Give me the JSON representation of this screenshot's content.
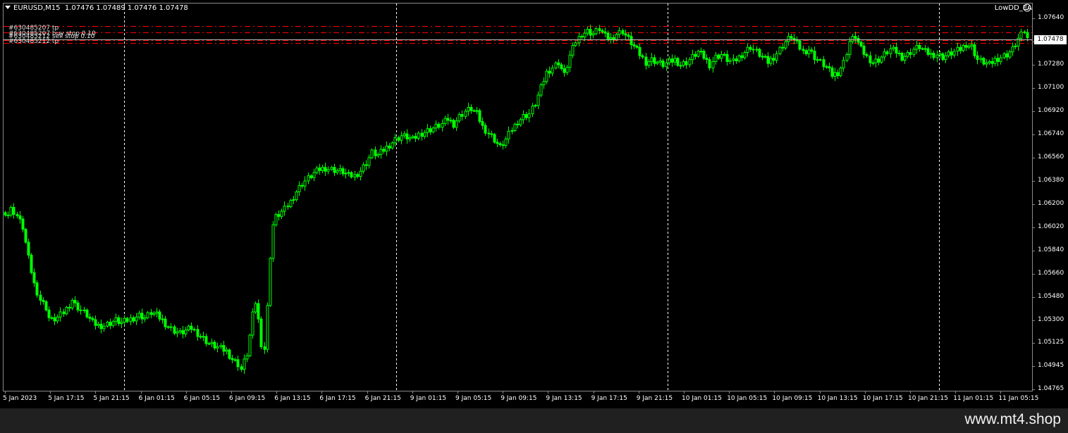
{
  "header": {
    "symbol": "EURUSD,M15",
    "ohlc": "1.07476 1.07489 1.07476 1.07478",
    "ea_name": "LowDD_EA"
  },
  "colors": {
    "background": "#000000",
    "candle": "#00ff00",
    "order_line": "#ff0000",
    "bid_line": "#c0c0c0",
    "grid": "#ffffff",
    "bottom_bar": "#202020"
  },
  "price_axis": [
    "1.07640",
    "1.07460",
    "1.07280",
    "1.07100",
    "1.06920",
    "1.06740",
    "1.06560",
    "1.06380",
    "1.06200",
    "1.06020",
    "1.05840",
    "1.05660",
    "1.05480",
    "1.05300",
    "1.05125",
    "1.04945",
    "1.04765"
  ],
  "current_price": "1.07478",
  "time_axis": [
    "5 Jan 2023",
    "5 Jan 17:15",
    "5 Jan 21:15",
    "6 Jan 01:15",
    "6 Jan 05:15",
    "6 Jan 09:15",
    "6 Jan 13:15",
    "6 Jan 17:15",
    "6 Jan 21:15",
    "9 Jan 01:15",
    "9 Jan 05:15",
    "9 Jan 09:15",
    "9 Jan 13:15",
    "9 Jan 17:15",
    "9 Jan 21:15",
    "10 Jan 01:15",
    "10 Jan 05:15",
    "10 Jan 09:15",
    "10 Jan 13:15",
    "10 Jan 17:15",
    "10 Jan 21:15",
    "11 Jan 01:15",
    "11 Jan 05:15"
  ],
  "order_labels": [
    "#630485207 tp",
    "#630485207 buy stop 0.10",
    "#630485212 sell stop 0.10",
    "#630485212 tp"
  ],
  "order_levels": [
    1.0758,
    1.0753,
    1.0747,
    1.0745
  ],
  "session_separators": [
    "5 Jan 21:15",
    "6 Jan 21:15",
    "9 Jan 21:15",
    "10 Jan 21:15"
  ],
  "price_path": [
    [
      0,
      1.0614
    ],
    [
      1,
      1.0612
    ],
    [
      2,
      1.0616
    ],
    [
      3,
      1.0614
    ],
    [
      4,
      1.0611
    ],
    [
      6,
      1.0602
    ],
    [
      7,
      1.059
    ],
    [
      8,
      1.0578
    ],
    [
      9,
      1.0568
    ],
    [
      10,
      1.0558
    ],
    [
      11,
      1.0552
    ],
    [
      12,
      1.0546
    ],
    [
      14,
      1.054
    ],
    [
      15,
      1.0532
    ],
    [
      16,
      1.053
    ],
    [
      18,
      1.0532
    ],
    [
      20,
      1.0536
    ],
    [
      22,
      1.0542
    ],
    [
      23,
      1.0546
    ],
    [
      24,
      1.0542
    ],
    [
      26,
      1.0538
    ],
    [
      28,
      1.0534
    ],
    [
      30,
      1.0528
    ],
    [
      32,
      1.0526
    ],
    [
      34,
      1.0526
    ],
    [
      36,
      1.0528
    ],
    [
      38,
      1.053
    ],
    [
      40,
      1.0528
    ],
    [
      42,
      1.053
    ],
    [
      44,
      1.0532
    ],
    [
      46,
      1.0534
    ],
    [
      48,
      1.0532
    ],
    [
      50,
      1.0536
    ],
    [
      52,
      1.0534
    ],
    [
      54,
      1.053
    ],
    [
      56,
      1.0525
    ],
    [
      58,
      1.0522
    ],
    [
      60,
      1.052
    ],
    [
      62,
      1.0522
    ],
    [
      64,
      1.0524
    ],
    [
      66,
      1.052
    ],
    [
      68,
      1.0516
    ],
    [
      70,
      1.0512
    ],
    [
      72,
      1.051
    ],
    [
      74,
      1.0508
    ],
    [
      76,
      1.0506
    ],
    [
      78,
      1.05
    ],
    [
      80,
      1.0496
    ],
    [
      81,
      1.0492
    ],
    [
      82,
      1.0498
    ],
    [
      83,
      1.0504
    ],
    [
      84,
      1.0518
    ],
    [
      85,
      1.0534
    ],
    [
      86,
      1.0544
    ],
    [
      87,
      1.053
    ],
    [
      88,
      1.0512
    ],
    [
      89,
      1.0508
    ],
    [
      90,
      1.054
    ],
    [
      91,
      1.058
    ],
    [
      92,
      1.0604
    ],
    [
      93,
      1.061
    ],
    [
      94,
      1.0612
    ],
    [
      96,
      1.0616
    ],
    [
      98,
      1.0622
    ],
    [
      100,
      1.063
    ],
    [
      102,
      1.0636
    ],
    [
      104,
      1.064
    ],
    [
      106,
      1.0644
    ],
    [
      108,
      1.0647
    ],
    [
      110,
      1.0648
    ],
    [
      112,
      1.0647
    ],
    [
      114,
      1.0646
    ],
    [
      116,
      1.0645
    ],
    [
      118,
      1.0642
    ],
    [
      120,
      1.0642
    ],
    [
      122,
      1.0646
    ],
    [
      124,
      1.0652
    ],
    [
      126,
      1.066
    ],
    [
      128,
      1.0658
    ],
    [
      130,
      1.0662
    ],
    [
      132,
      1.0666
    ],
    [
      134,
      1.067
    ],
    [
      136,
      1.0673
    ],
    [
      138,
      1.0672
    ],
    [
      140,
      1.067
    ],
    [
      142,
      1.0674
    ],
    [
      144,
      1.0676
    ],
    [
      146,
      1.0678
    ],
    [
      148,
      1.068
    ],
    [
      150,
      1.0682
    ],
    [
      152,
      1.0686
    ],
    [
      154,
      1.0682
    ],
    [
      156,
      1.0688
    ],
    [
      158,
      1.0692
    ],
    [
      160,
      1.0694
    ],
    [
      162,
      1.069
    ],
    [
      164,
      1.068
    ],
    [
      166,
      1.0675
    ],
    [
      168,
      1.067
    ],
    [
      170,
      1.0664
    ],
    [
      172,
      1.067
    ],
    [
      174,
      1.0678
    ],
    [
      176,
      1.0684
    ],
    [
      178,
      1.0688
    ],
    [
      180,
      1.069
    ],
    [
      182,
      1.0698
    ],
    [
      184,
      1.071
    ],
    [
      186,
      1.0722
    ],
    [
      188,
      1.0726
    ],
    [
      190,
      1.073
    ],
    [
      192,
      1.072
    ],
    [
      194,
      1.0735
    ],
    [
      196,
      1.0746
    ],
    [
      198,
      1.0752
    ],
    [
      200,
      1.0754
    ],
    [
      202,
      1.0752
    ],
    [
      204,
      1.0756
    ],
    [
      206,
      1.075
    ],
    [
      208,
      1.0748
    ],
    [
      210,
      1.0752
    ],
    [
      212,
      1.0754
    ],
    [
      214,
      1.0748
    ],
    [
      216,
      1.0742
    ],
    [
      218,
      1.0736
    ],
    [
      220,
      1.073
    ],
    [
      222,
      1.0732
    ],
    [
      224,
      1.073
    ],
    [
      226,
      1.0728
    ],
    [
      228,
      1.073
    ],
    [
      230,
      1.0732
    ],
    [
      232,
      1.0728
    ],
    [
      234,
      1.073
    ],
    [
      236,
      1.0734
    ],
    [
      238,
      1.0738
    ],
    [
      240,
      1.0734
    ],
    [
      242,
      1.0728
    ],
    [
      244,
      1.0734
    ],
    [
      246,
      1.0736
    ],
    [
      248,
      1.0732
    ],
    [
      250,
      1.073
    ],
    [
      252,
      1.0734
    ],
    [
      254,
      1.0738
    ],
    [
      256,
      1.0742
    ],
    [
      258,
      1.0738
    ],
    [
      260,
      1.0734
    ],
    [
      262,
      1.073
    ],
    [
      264,
      1.0734
    ],
    [
      266,
      1.074
    ],
    [
      268,
      1.0746
    ],
    [
      270,
      1.075
    ],
    [
      272,
      1.0744
    ],
    [
      274,
      1.0738
    ],
    [
      276,
      1.074
    ],
    [
      278,
      1.0734
    ],
    [
      280,
      1.073
    ],
    [
      282,
      1.0726
    ],
    [
      284,
      1.072
    ],
    [
      286,
      1.0722
    ],
    [
      288,
      1.073
    ],
    [
      290,
      1.0746
    ],
    [
      292,
      1.075
    ],
    [
      294,
      1.074
    ],
    [
      296,
      1.0734
    ],
    [
      298,
      1.073
    ],
    [
      300,
      1.0732
    ],
    [
      302,
      1.0736
    ],
    [
      304,
      1.074
    ],
    [
      306,
      1.0738
    ],
    [
      308,
      1.0734
    ],
    [
      310,
      1.0736
    ],
    [
      312,
      1.074
    ],
    [
      314,
      1.0742
    ],
    [
      316,
      1.0738
    ],
    [
      318,
      1.0736
    ],
    [
      320,
      1.0736
    ],
    [
      322,
      1.0734
    ],
    [
      324,
      1.0736
    ],
    [
      326,
      1.0738
    ],
    [
      328,
      1.074
    ],
    [
      330,
      1.0744
    ],
    [
      332,
      1.0742
    ],
    [
      334,
      1.0732
    ],
    [
      336,
      1.073
    ],
    [
      338,
      1.0728
    ],
    [
      340,
      1.0732
    ],
    [
      342,
      1.0734
    ],
    [
      344,
      1.0736
    ],
    [
      346,
      1.074
    ],
    [
      348,
      1.0748
    ],
    [
      350,
      1.0754
    ],
    [
      351,
      1.0748
    ]
  ]
}
